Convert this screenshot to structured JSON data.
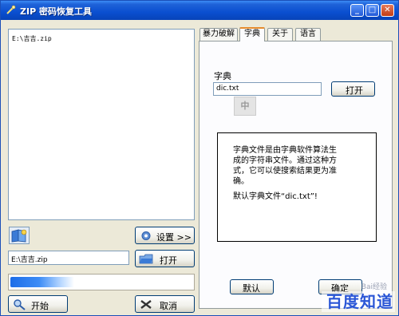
{
  "window": {
    "title": "ZIP 密码恢复工具",
    "minimize_glyph": "_",
    "maximize_glyph": "□",
    "close_glyph": "✕"
  },
  "file_list": {
    "items": [
      "E:\\吉吉.zip"
    ]
  },
  "left_controls": {
    "settings_label": "设置 >>",
    "path_value": "E:\\吉吉.zip",
    "open_label": "打开",
    "progress_percent": 35,
    "start_label": "开始",
    "cancel_label": "取消"
  },
  "tabs": [
    {
      "label": "暴力破解",
      "active": false
    },
    {
      "label": "字典",
      "active": true
    },
    {
      "label": "关于",
      "active": false
    },
    {
      "label": "语言",
      "active": false
    }
  ],
  "dictionary": {
    "section_label": "字典",
    "file_value": "dic.txt",
    "open_label": "打开",
    "ime_indicator": "中",
    "info_lines": [
      "字典文件是由字典软件算法生",
      "成的字符串文件。通过这种方",
      "式，它可以使搜索结果更为准",
      "确。",
      "默认字典文件“dic.txt”!"
    ],
    "default_label": "默认",
    "ok_label": "确定"
  },
  "watermark": {
    "text": "百度知道",
    "subtext": "Bai经验"
  },
  "colors": {
    "title_bar": "#0a4fd0",
    "tab_highlight": "#e68b2c",
    "progress": "#1d6de8"
  }
}
